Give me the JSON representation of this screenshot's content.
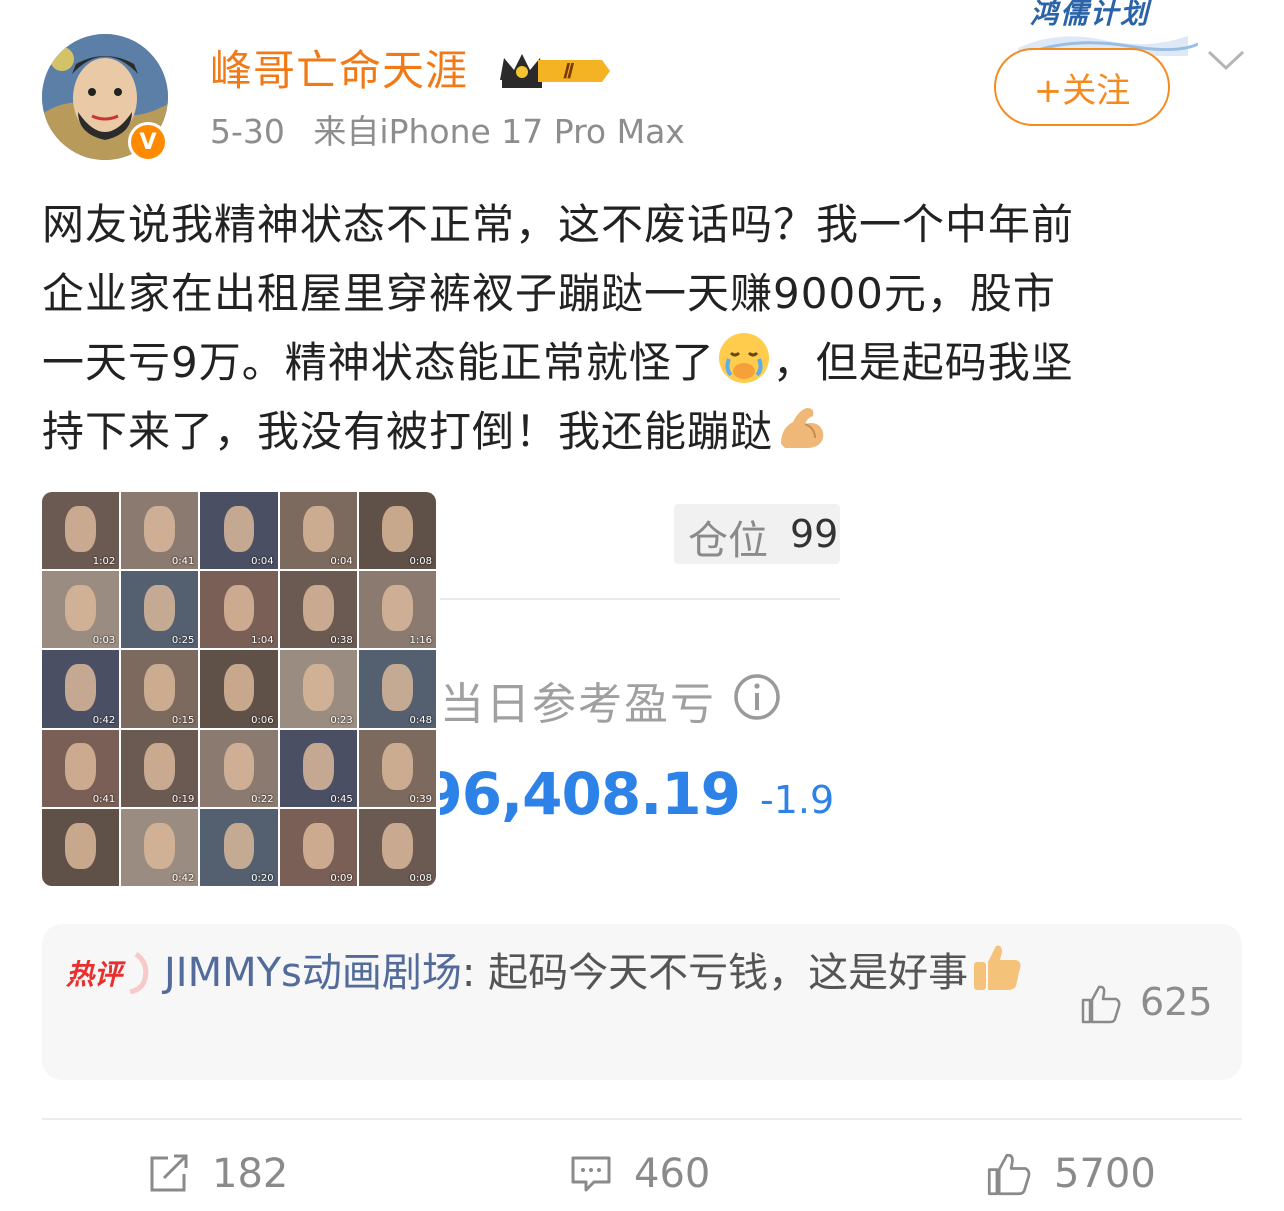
{
  "header": {
    "username": "峰哥亡命天涯",
    "rank_badge": "Ⅱ",
    "date": "5-30",
    "source": "来自iPhone 17 Pro Max",
    "verified_icon": "v-verified-icon",
    "follow_label": "+关注",
    "brand_banner": "鸿儒计划"
  },
  "post": {
    "line1": "网友说我精神状态不正常，这不废话吗？我一个中年前",
    "line2": "企业家在出租屋里穿裤衩子蹦跶一天赚9000元，股市",
    "line3a": "一天亏9万。精神状态能正常就怪了",
    "line3b": "，但是起码我坚",
    "line4": "持下来了，我没有被打倒！我还能蹦跶",
    "emoji1": "crying-face-emoji",
    "emoji2": "flexed-biceps-emoji"
  },
  "media": {
    "durations": [
      "1:02",
      "0:41",
      "0:04",
      "0:04",
      "0:08",
      "0:03",
      "0:25",
      "1:04",
      "0:38",
      "1:16",
      "0:42",
      "0:15",
      "0:06",
      "0:23",
      "0:48",
      "0:41",
      "0:19",
      "0:22",
      "0:45",
      "0:39",
      "",
      "0:42",
      "0:20",
      "0:09",
      "0:08"
    ],
    "screenshot": {
      "position_label": "仓位",
      "position_value": "99",
      "pnl_label": "当日参考盈亏",
      "pnl_value": "-96,408.19",
      "pnl_pct": "-1.9"
    }
  },
  "hot_comment": {
    "tag": "热评",
    "user": "JIMMYs动画剧场",
    "text": ": 起码今天不亏钱，这是好事",
    "emoji": "thumbs-up-emoji",
    "likes": "625"
  },
  "actions": {
    "reposts": "182",
    "comments": "460",
    "likes": "5700"
  },
  "colors": {
    "accent_orange": "#f27a16",
    "link_blue": "#536b9a",
    "stock_blue": "#2d82e8"
  }
}
